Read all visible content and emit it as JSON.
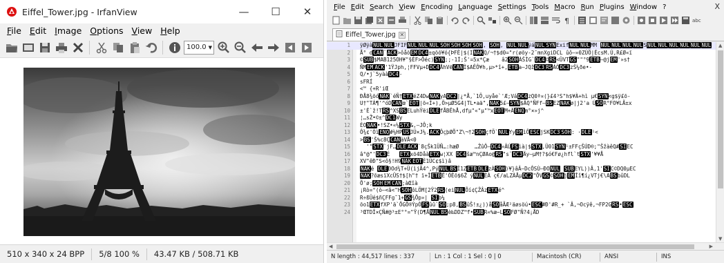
{
  "irfanview": {
    "title": "Eiffel_Tower.jpg - IrfanView",
    "window_buttons": {
      "minimize": "—",
      "maximize": "☐",
      "close": "✕"
    },
    "menu": [
      "File",
      "Edit",
      "Image",
      "Options",
      "View",
      "Help"
    ],
    "zoom_value": "100.0",
    "status": {
      "dimensions": "510 x 340 x 24 BPP",
      "position": "5/8  100 %",
      "size": "43.47 KB / 508.71 KB"
    },
    "toolbar_icons": [
      "open-folder-icon",
      "slideshow-icon",
      "save-icon",
      "print-icon",
      "delete-icon",
      "cut-icon",
      "copy-icon",
      "paste-icon",
      "undo-icon",
      "info-icon",
      "zoom-select",
      "zoom-in-icon",
      "zoom-out-icon",
      "previous-icon",
      "next-icon",
      "first-icon",
      "last-icon"
    ]
  },
  "notepadpp": {
    "menu": [
      "File",
      "Edit",
      "Search",
      "View",
      "Encoding",
      "Language",
      "Settings",
      "Tools",
      "Macro",
      "Run",
      "Plugins",
      "Window",
      "?"
    ],
    "close_label": "X",
    "tab_label": "Eiffel_Tower.jpg",
    "current_line": 1,
    "lines": [
      {
        "n": "1",
        "code": "ÿØÿàNULNULJFIFNULNULNULSOHSOHSOHSOH, SOH, NULNULÿáNULSYNExifNULNULMM NULNULNULNULSNULNULNULNULNULNUL"
      },
      {
        "n": "2",
        "code": "Å° dCAN¨ACK>ôåõEMDC4±qõõ¥ó{ÞFÈ|$(INAKQ/¬†$d0=\"r(øõy-2¯mnXgiDCL ûô–»0ZÚÖ|ÉcsM.Ú,R£Ø«ï"
      },
      {
        "n": "3",
        "code": "©SUB$MAB1ž5OH¥\"§ÉF>Õéc)SYN;;-1Í;Š'=5x*Çæ    â2SOHÀŠÌG`DC4©RS<ÜVTGS\"\"°9ETB–@jEM'»s†"
      },
      {
        "n": "4",
        "code": "ÑMEMACK'1ŸJph,¦FFVµ+DDC4ÅhVëCANÌ$AÊÔ¥h,µ>*î+,ETBa–JQžDC3RSÀÒDC3zŠ¼ðe•-"
      },
      {
        "n": "5",
        "code": "Q/•j`5yààDC4-"
      },
      {
        "n": "6",
        "code": "sFRÍ"
      },
      {
        "n": "7",
        "code": "<™ {+R'iŒ"
      },
      {
        "n": "8",
        "code": "ÐÅ8¾õóNAK`éÑ†ETXéZ4DwNAKyADC2|¿*Å,`1Ö,uyåe`'Æ;VáDC4zQ0ª¤(}£4³S\"h$¥À+hì µ€SYN<g$ÿ£õ-"
      },
      {
        "n": "9",
        "code": "U†\"TÁ¶'^óDCANœ`EOT|ö«Í+),Ö>µØ5G4|TL•aä\",NAK5£–SYN$ÂQ°ÑFf–BSEZNAKø|j2'a ÚSOR°FO¥LÃ±x"
      },
      {
        "n": "10",
        "code": "±'É`ž!TRS^XSBSELuhŸëiDLEfÅBÊhÅ,dfµ\"«\"µ\"™xEOTM+ÄENQm°×»j^"
      },
      {
        "n": "11",
        "code": "¦…sŽ•©±^DC1Wy"
      },
      {
        "n": "12",
        "code": "ÈONAK•!SZ•«¼STX&,–JÔ;k"
      },
      {
        "n": "13",
        "code": "Ô¾¢'ÒìENQ#¼HPUSJÜ×J¼.ACKÔçþØÕ\"Z\\¬†2SOHçfÖ`NULYyEMìÕESCjSKDC3SOH: ·DLE¹<"
      },
      {
        "n": "14",
        "code": ">BS'Š%c8ÇCANàVÅ<0"
      },
      {
        "n": "15",
        "code": "  '\"STX`jF…DLEACK`8çŠk1ÜÑ…:hæØ     …ŽûÔ–DC4»ÂÚFSìà|$STX,Ü01SYN¹±FFçŠÚD®;\"ŠžàêQ#SIEC"
      },
      {
        "n": "16",
        "code": "â°@\"'DC3É   ETXxõ4DåàETXw¦XX DC4šæ™nÇØAo@RS\"s¨DC3Äy–µM†?$ó€Fø¿hfl`tSTX'¥¥Å"
      },
      {
        "n": "17",
        "code": "XV\"êÐ\"S<ô§!H9NAKEOTÈ1ÜC¢$ì)â"
      },
      {
        "n": "18",
        "code": "NAKé DLEÐOd¾T+Ü(ìjÃ4^,PýNULBSÎ1ZETBDLEzÀSOH)¥}âÂ–DcÔSÙ–ÐONUL SUBEYL))Â,1'SIC©DQ0µEC"
      },
      {
        "n": "19",
        "code": "NAK?õæsïXcÛS†$[h\"† ï+ÎETBË'ÓÈõ$6Ž ýNULÈÀ ç€/aLZÀÅµDC2\"ÕVGS©SOHjEMÎî¶í¿VTj€\\ABSbûDL"
      },
      {
        "n": "20",
        "code": "Õ'ø;SOHEMCAN;àŒîà"
      },
      {
        "n": "21",
        "code": "¡Rò=°(ò–<â<\"HSOHôLÖM[2Ÿ2RS(eiNULÕí¢ÇŽÂzETXé^"
      },
      {
        "n": "22",
        "code": "R÷ßÜé$ñÇFFg˜1+GS¾Õp»| SIb¼"
      },
      {
        "n": "23",
        "code": "õo1ETXfXP'ä`ÕGÕ®ÝpÓFSûû`SO;p8,BSûŠ!±¿))åSOåÃÆ²äøsöú•ESC#Ð'#R_+ `Â,¬Ocÿê,¬FP2GRS•ESC"
      },
      {
        "n": "24",
        "code": "³ŒTDÎ×ÇÑ#@³±E°°=\"Ÿ(D¶ÅNULBSè‰DDZ™f•SUBR«%æ~LSOFØ\"Ñ?4¡ÅD"
      }
    ],
    "status": {
      "length": "N length : 44,517    lines : 337",
      "position": "Ln : 1    Col : 1    Sel : 0 | 0",
      "eol": "Macintosh (CR)",
      "encoding": "ANSI",
      "mode": "INS"
    }
  }
}
